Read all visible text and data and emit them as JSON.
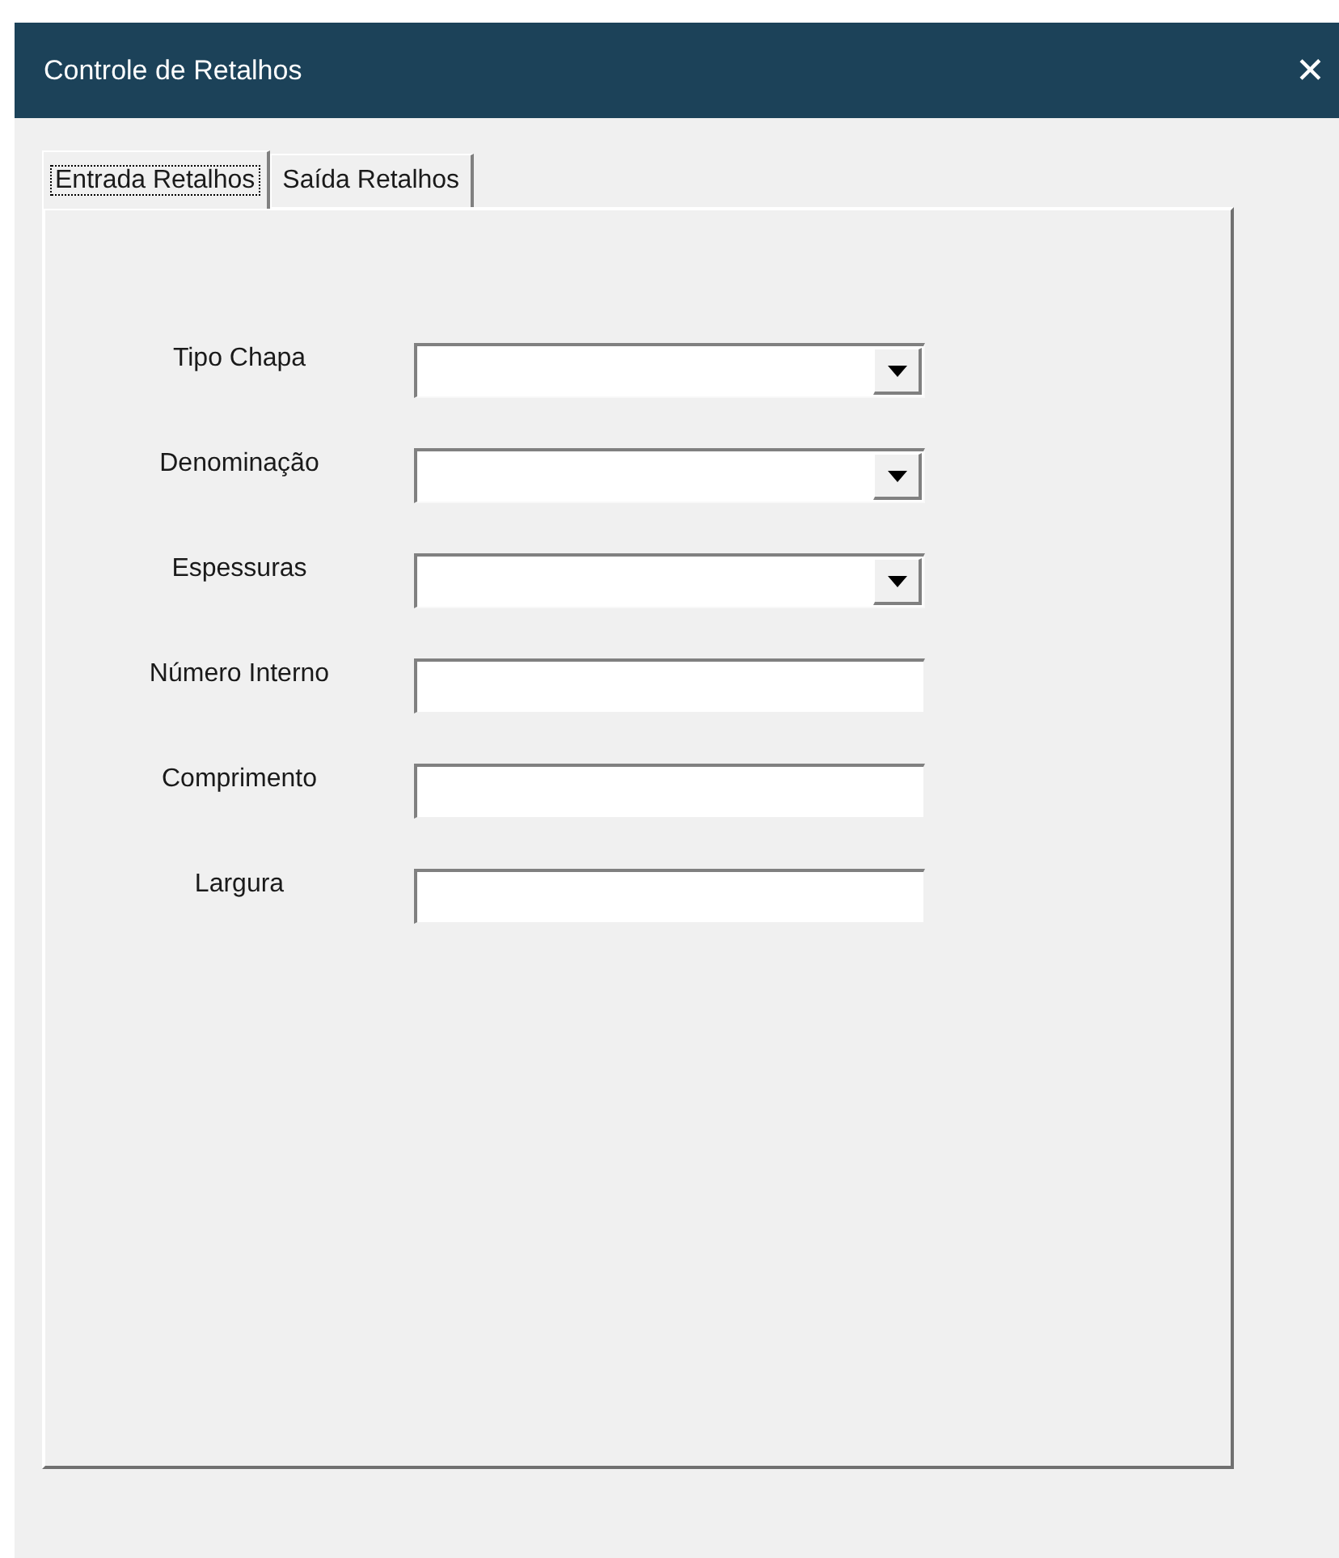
{
  "window": {
    "title": "Controle de Retalhos",
    "close": "✕"
  },
  "tabs": [
    {
      "label": "Entrada Retalhos",
      "selected": true
    },
    {
      "label": "Saída Retalhos",
      "selected": false
    }
  ],
  "fields": [
    {
      "label": "Tipo Chapa",
      "kind": "combo"
    },
    {
      "label": "Denominação",
      "kind": "combo"
    },
    {
      "label": "Espessuras",
      "kind": "combo"
    },
    {
      "label": "Número Interno",
      "kind": "text"
    },
    {
      "label": "Comprimento",
      "kind": "text"
    },
    {
      "label": "Largura",
      "kind": "text"
    }
  ]
}
